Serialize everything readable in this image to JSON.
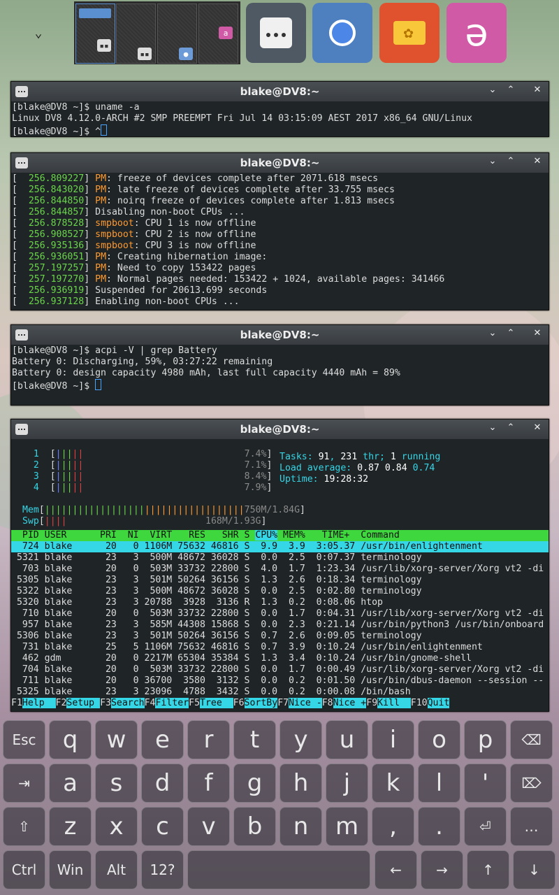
{
  "shelf": {
    "toggle_icon": "chevron-down-icon",
    "launchers": [
      {
        "name": "terminology",
        "icon": "terminal-icon",
        "color": "#4e5963"
      },
      {
        "name": "chromium",
        "icon": "chrome-icon",
        "color": "#4e7fbf"
      },
      {
        "name": "files",
        "icon": "folder-icon",
        "color": "#e0512e"
      },
      {
        "name": "onboard",
        "icon": "onboard-icon",
        "color": "#d05aa5"
      }
    ]
  },
  "windows": {
    "w1": {
      "title": "blake@DV8:~",
      "lines": [
        "[blake@DV8 ~]$ uname -a",
        "Linux DV8 4.12.0-ARCH #2 SMP PREEMPT Fri Jul 14 03:15:09 AEST 2017 x86_64 GNU/Linux",
        "[blake@DV8 ~]$ ^"
      ]
    },
    "w2": {
      "title": "blake@DV8:~",
      "lines": [
        {
          "ts": "[  256.809227]",
          "tag": "PM",
          "rest": ": freeze of devices complete after 2071.618 msecs"
        },
        {
          "ts": "[  256.843020]",
          "tag": "PM",
          "rest": ": late freeze of devices complete after 33.755 msecs"
        },
        {
          "ts": "[  256.844850]",
          "tag": "PM",
          "rest": ": noirq freeze of devices complete after 1.813 msecs"
        },
        {
          "ts": "[  256.844857]",
          "tag": "",
          "rest": " Disabling non-boot CPUs ..."
        },
        {
          "ts": "[  256.878528]",
          "tag": "smpboot",
          "rest": ": CPU 1 is now offline"
        },
        {
          "ts": "[  256.908527]",
          "tag": "smpboot",
          "rest": ": CPU 2 is now offline"
        },
        {
          "ts": "[  256.935136]",
          "tag": "smpboot",
          "rest": ": CPU 3 is now offline"
        },
        {
          "ts": "[  256.936051]",
          "tag": "PM",
          "rest": ": Creating hibernation image:"
        },
        {
          "ts": "[  257.197257]",
          "tag": "PM",
          "rest": ": Need to copy 153422 pages"
        },
        {
          "ts": "[  257.197270]",
          "tag": "PM",
          "rest": ": Normal pages needed: 153422 + 1024, available pages: 341466"
        },
        {
          "ts": "[  256.936919]",
          "tag": "",
          "rest": " Suspended for 20613.699 seconds"
        },
        {
          "ts": "[  256.937128]",
          "tag": "",
          "rest": " Enabling non-boot CPUs ..."
        }
      ]
    },
    "w3": {
      "title": "blake@DV8:~",
      "lines": [
        "[blake@DV8 ~]$ acpi -V | grep Battery",
        "Battery 0: Discharging, 59%, 03:27:22 remaining",
        "Battery 0: design capacity 4980 mAh, last full capacity 4440 mAh = 89%",
        "[blake@DV8 ~]$ "
      ]
    },
    "w4": {
      "title": "blake@DV8:~",
      "cpus": [
        {
          "id": "1",
          "pct": "7.4%"
        },
        {
          "id": "2",
          "pct": "7.1%"
        },
        {
          "id": "3",
          "pct": "8.4%"
        },
        {
          "id": "4",
          "pct": "7.9%"
        }
      ],
      "mem": {
        "label": "Mem",
        "value": "750M/1.84G"
      },
      "swp": {
        "label": "Swp",
        "value": "168M/1.93G"
      },
      "tasks_label": "Tasks: ",
      "tasks": "91",
      "thr": "231",
      "thr_label": " thr; ",
      "running": "1",
      "running_label": " running",
      "load_label": "Load average: ",
      "load1": "0.87",
      "load5": "0.84",
      "load15": "0.74",
      "uptime_label": "Uptime: ",
      "uptime": "19:28:32",
      "header": "  PID USER      PRI  NI  VIRT   RES   SHR S ",
      "header_sort": "CPU%",
      "header_rest": " MEM%   TIME+  Command",
      "rows": [
        {
          "text": "  724 blake      20   0 1106M 75632 46816 S  9.9  3.9  3:05.37 /usr/bin/enlightenment",
          "sel": true
        },
        {
          "text": " 5321 blake      23   3  500M 48672 36028 S  0.0  2.5  0:07.37 terminology"
        },
        {
          "text": "  703 blake      20   0  503M 33732 22800 S  4.0  1.7  1:23.34 /usr/lib/xorg-server/Xorg vt2 -di"
        },
        {
          "text": " 5305 blake      23   3  501M 50264 36156 S  1.3  2.6  0:18.34 terminology"
        },
        {
          "text": " 5322 blake      23   3  500M 48672 36028 S  0.0  2.5  0:02.80 terminology"
        },
        {
          "text": " 5320 blake      23   3 20788  3928  3136 R  1.3  0.2  0:08.06 htop"
        },
        {
          "text": "  710 blake      20   0  503M 33732 22800 S  0.0  1.7  0:04.31 /usr/lib/xorg-server/Xorg vt2 -di"
        },
        {
          "text": "  957 blake      23   3  585M 44308 15868 S  0.0  2.3  0:21.14 /usr/bin/python3 /usr/bin/onboard"
        },
        {
          "text": " 5306 blake      23   3  501M 50264 36156 S  0.7  2.6  0:09.05 terminology"
        },
        {
          "text": "  731 blake      25   5 1106M 75632 46816 S  0.7  3.9  0:10.24 /usr/bin/enlightenment"
        },
        {
          "text": "  462 gdm        20   0 2217M 65304 35384 S  1.3  3.4  0:10.24 /usr/bin/gnome-shell"
        },
        {
          "text": "  704 blake      20   0  503M 33732 22800 S  0.0  1.7  0:00.49 /usr/lib/xorg-server/Xorg vt2 -di"
        },
        {
          "text": "  711 blake      20   0 36700  3580  3132 S  0.0  0.2  0:01.50 /usr/bin/dbus-daemon --session --"
        },
        {
          "text": " 5325 blake      23   3 23096  4788  3432 S  0.0  0.2  0:00.08 /bin/bash"
        }
      ],
      "fkeys": [
        {
          "k": "F1",
          "l": "Help  "
        },
        {
          "k": "F2",
          "l": "Setup "
        },
        {
          "k": "F3",
          "l": "Search"
        },
        {
          "k": "F4",
          "l": "Filter"
        },
        {
          "k": "F5",
          "l": "Tree  "
        },
        {
          "k": "F6",
          "l": "SortBy"
        },
        {
          "k": "F7",
          "l": "Nice -"
        },
        {
          "k": "F8",
          "l": "Nice +"
        },
        {
          "k": "F9",
          "l": "Kill  "
        },
        {
          "k": "F10",
          "l": "Quit"
        }
      ]
    }
  },
  "keyboard": {
    "row1": [
      "Esc",
      "q",
      "w",
      "e",
      "r",
      "t",
      "y",
      "u",
      "i",
      "o",
      "p",
      "⌫"
    ],
    "row2": [
      "⇥",
      "a",
      "s",
      "d",
      "f",
      "g",
      "h",
      "j",
      "k",
      "l",
      "'",
      "⌦"
    ],
    "row3": [
      "⇧",
      "z",
      "x",
      "c",
      "v",
      "b",
      "n",
      "m",
      ",",
      ".",
      "⏎",
      "…"
    ],
    "row4": [
      "Ctrl",
      "Win",
      "Alt",
      "12?",
      "",
      "←",
      "→",
      "↑",
      "↓"
    ]
  }
}
